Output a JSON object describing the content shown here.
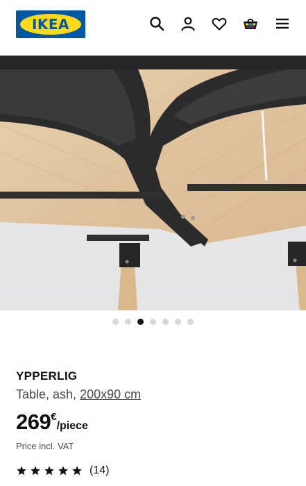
{
  "header": {
    "logo_text": "IKEA",
    "icons": [
      "search-icon",
      "account-icon",
      "heart-icon",
      "shopping-bag-icon",
      "menu-icon"
    ]
  },
  "gallery": {
    "image_count": 7,
    "active_index": 2
  },
  "product": {
    "name": "YPPERLIG",
    "description": "Table, ash,",
    "size": "200x90 cm",
    "price_value": "269",
    "price_currency": "€",
    "price_unit": "/piece",
    "vat_note": "Price incl. VAT",
    "rating_stars": 5,
    "rating_count": "(14)"
  },
  "colors": {
    "brand_blue": "#0058a3",
    "brand_yellow": "#ffda1a",
    "text": "#111111",
    "muted": "#484848"
  }
}
